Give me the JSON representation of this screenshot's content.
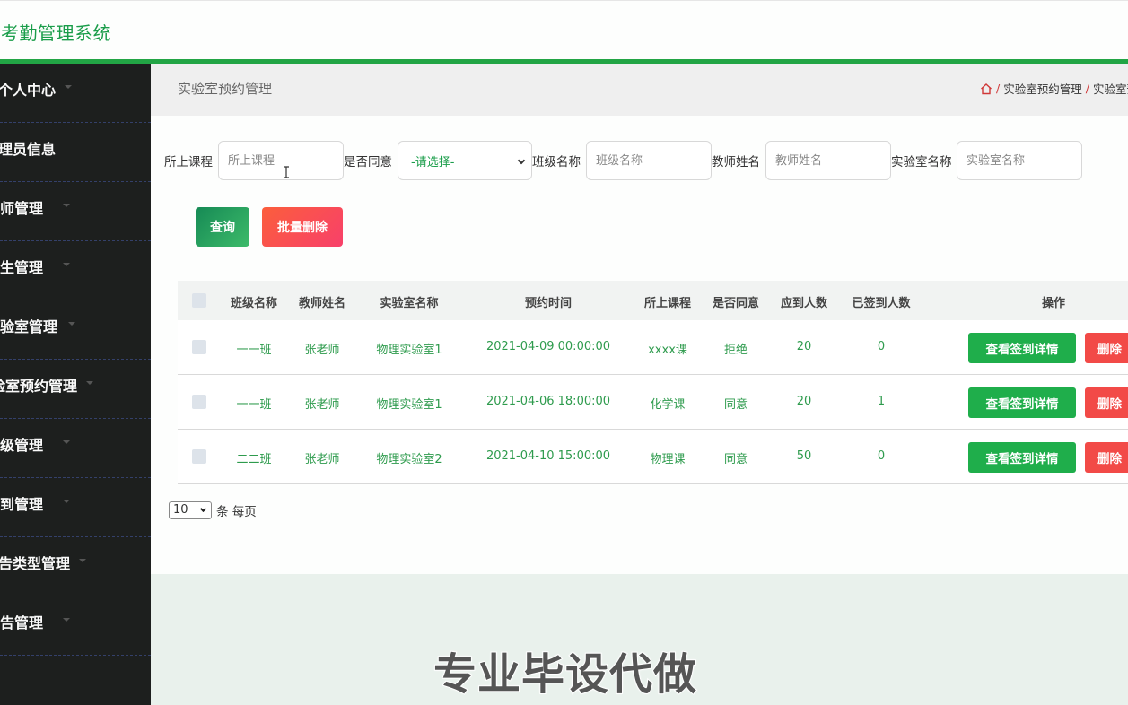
{
  "app": {
    "title": "实验考勤管理系统"
  },
  "sidebar": {
    "items": [
      {
        "label": "个人中心"
      },
      {
        "label": "管理员信息"
      },
      {
        "label": "教师管理"
      },
      {
        "label": "学生管理"
      },
      {
        "label": "实验室管理"
      },
      {
        "label": "实验室预约管理"
      },
      {
        "label": "班级管理"
      },
      {
        "label": "签到管理"
      },
      {
        "label": "公告类型管理"
      },
      {
        "label": "公告管理"
      }
    ]
  },
  "page": {
    "title": "实验室预约管理",
    "breadcrumb": [
      "实验室预约管理",
      "实验室预约管理"
    ]
  },
  "filters": {
    "course": {
      "label": "所上课程",
      "placeholder": "所上课程"
    },
    "agree": {
      "label": "是否同意",
      "value": "-请选择-"
    },
    "class": {
      "label": "班级名称",
      "placeholder": "班级名称"
    },
    "teacher": {
      "label": "教师姓名",
      "placeholder": "教师姓名"
    },
    "lab": {
      "label": "实验室名称",
      "placeholder": "实验室名称"
    }
  },
  "actions": {
    "query": "查询",
    "batch_delete": "批量删除"
  },
  "table": {
    "headers": [
      "班级名称",
      "教师姓名",
      "实验室名称",
      "预约时间",
      "所上课程",
      "是否同意",
      "应到人数",
      "已签到人数",
      "操作"
    ],
    "rows": [
      {
        "class": "一一班",
        "teacher": "张老师",
        "lab": "物理实验室1",
        "time": "2021-04-09 00:00:00",
        "course": "xxxx课",
        "agree": "拒绝",
        "expected": "20",
        "signed": "0"
      },
      {
        "class": "一一班",
        "teacher": "张老师",
        "lab": "物理实验室1",
        "time": "2021-04-06 18:00:00",
        "course": "化学课",
        "agree": "同意",
        "expected": "20",
        "signed": "1"
      },
      {
        "class": "二二班",
        "teacher": "张老师",
        "lab": "物理实验室2",
        "time": "2021-04-10 15:00:00",
        "course": "物理课",
        "agree": "同意",
        "expected": "50",
        "signed": "0"
      }
    ],
    "detail_button": "查看签到详情",
    "delete_button": "删除"
  },
  "pager": {
    "page_size": "10",
    "suffix": "条 每页"
  },
  "watermark": "专业毕设代做",
  "colors": {
    "accent": "#22a545",
    "text_green": "#2e9b4d",
    "danger": "#f24a47",
    "sidebar_bg": "#1d1f1e"
  },
  "icons": {
    "home": "home-icon",
    "dropdown": "chevron-down-icon"
  }
}
